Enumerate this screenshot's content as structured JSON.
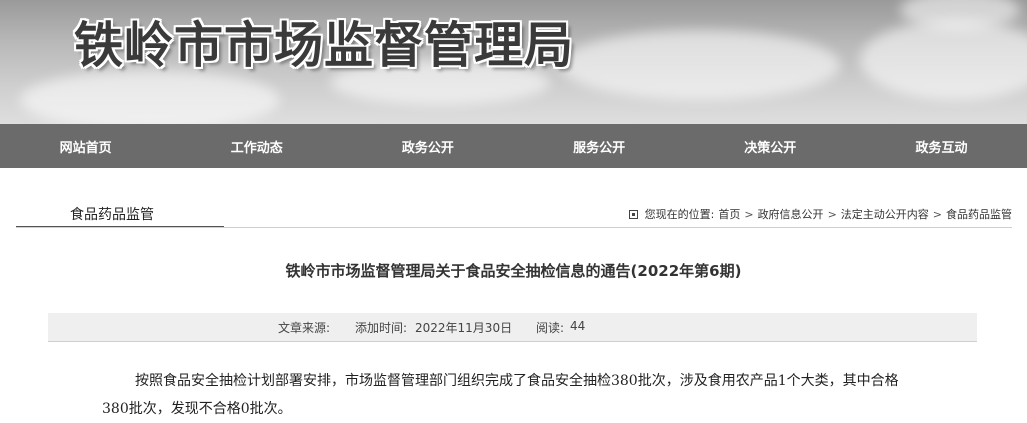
{
  "site": {
    "title": "铁岭市市场监督管理局"
  },
  "nav": {
    "items": [
      {
        "label": "网站首页"
      },
      {
        "label": "工作动态"
      },
      {
        "label": "政务公开"
      },
      {
        "label": "服务公开"
      },
      {
        "label": "决策公开"
      },
      {
        "label": "政务互动"
      }
    ]
  },
  "section": {
    "name": "食品药品监管"
  },
  "breadcrumb": {
    "prefix": "您现在的位置:",
    "items": [
      "首页",
      "政府信息公开",
      "法定主动公开内容",
      "食品药品监管"
    ],
    "separator": ">"
  },
  "article": {
    "title": "铁岭市市场监督管理局关于食品安全抽检信息的通告(2022年第6期)",
    "source_label": "文章来源:",
    "source_value": "",
    "date_label": "添加时间:",
    "date_value": "2022年11月30日",
    "reads_label": "阅读:",
    "reads_value": "44",
    "body": "按照食品安全抽检计划部署安排，市场监督管理部门组织完成了食品安全抽检380批次，涉及食用农产品1个大类，其中合格380批次，发现不合格0批次。"
  },
  "colors": {
    "nav_bg": "#6b6b6b",
    "banner_text": "#3a3a3a",
    "meta_bg": "#efefef"
  }
}
